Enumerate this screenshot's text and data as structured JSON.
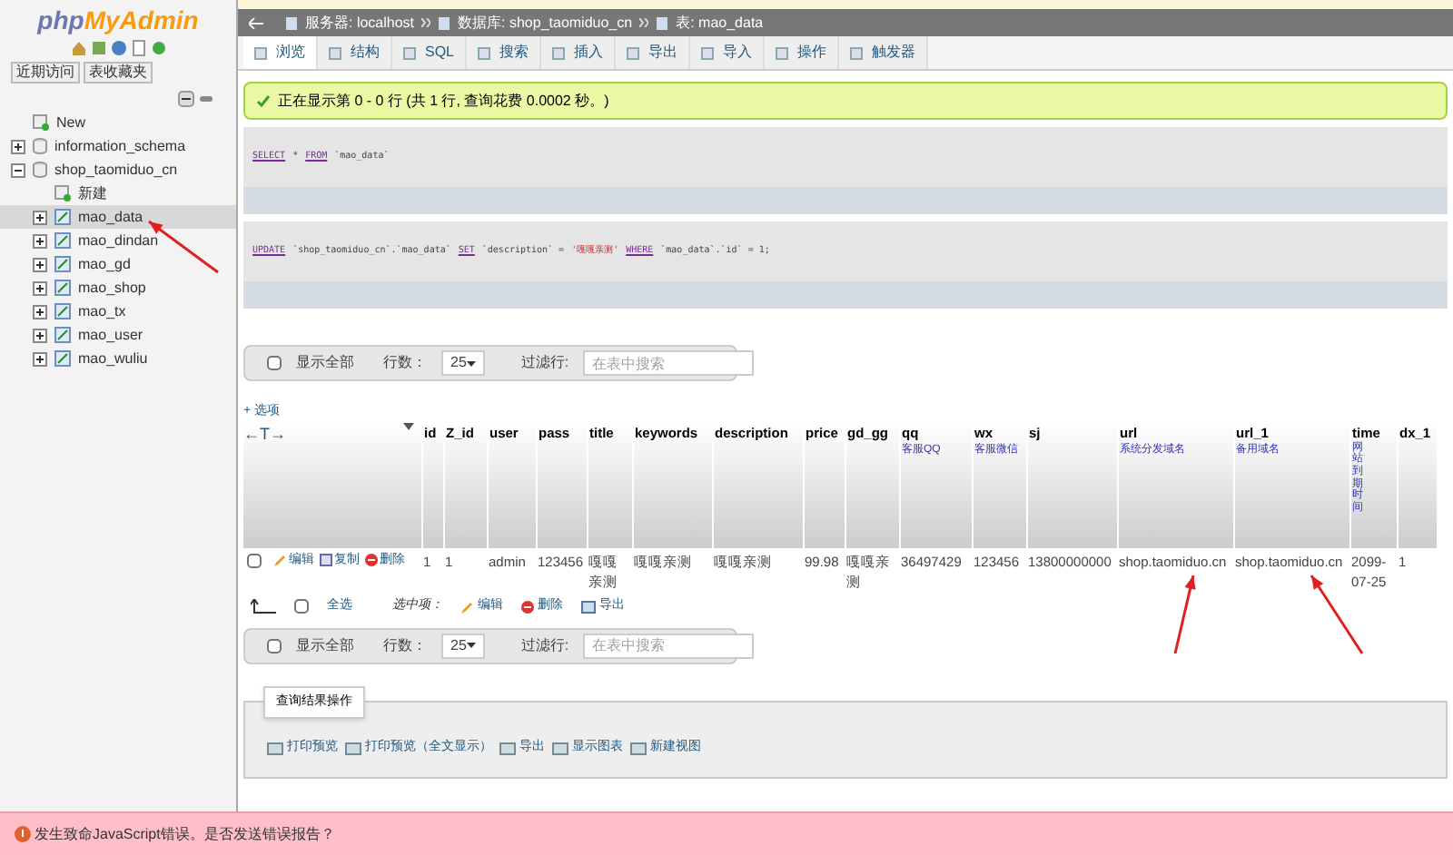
{
  "sidebar": {
    "logo": {
      "part_1": "php",
      "part_2": "MyAdmin"
    },
    "buttons": [
      "近期访问",
      "表收藏夹"
    ],
    "tree": [
      {
        "label": "New",
        "kind": "new",
        "selected": false
      },
      {
        "label": "information_schema",
        "kind": "db",
        "expanded": false,
        "selected": false
      },
      {
        "label": "shop_taomiduo_cn",
        "kind": "db",
        "expanded": true,
        "selected": false,
        "children": [
          {
            "label": "新建",
            "kind": "new",
            "selected": false
          },
          {
            "label": "mao_data",
            "kind": "table",
            "expanded": false,
            "selected": true
          },
          {
            "label": "mao_dindan",
            "kind": "table",
            "expanded": false,
            "selected": false
          },
          {
            "label": "mao_gd",
            "kind": "table",
            "expanded": false,
            "selected": false
          },
          {
            "label": "mao_shop",
            "kind": "table",
            "expanded": false,
            "selected": false
          },
          {
            "label": "mao_tx",
            "kind": "table",
            "expanded": false,
            "selected": false
          },
          {
            "label": "mao_user",
            "kind": "table",
            "expanded": false,
            "selected": false
          },
          {
            "label": "mao_wuliu",
            "kind": "table",
            "expanded": false,
            "selected": false
          }
        ]
      }
    ]
  },
  "breadcrumb": [
    "服务器: localhost",
    "数据库: shop_taomiduo_cn",
    "表: mao_data"
  ],
  "tabs": [
    {
      "label": "浏览",
      "selected": true
    },
    {
      "label": "结构",
      "selected": false
    },
    {
      "label": "SQL",
      "selected": false
    },
    {
      "label": "搜索",
      "selected": false
    },
    {
      "label": "插入",
      "selected": false
    },
    {
      "label": "导出",
      "selected": false
    },
    {
      "label": "导入",
      "selected": false
    },
    {
      "label": "操作",
      "selected": false
    },
    {
      "label": "触发器",
      "selected": false
    }
  ],
  "success_message": "正在显示第 0 - 0 行 (共 1 行, 查询花费 0.0002 秒。)",
  "queries": [
    [
      {
        "kind": "keyword",
        "text": "SELECT"
      },
      {
        "kind": "plain",
        "text": "*"
      },
      {
        "kind": "keyword",
        "text": "FROM"
      },
      {
        "kind": "plain",
        "text": "`mao_data`"
      }
    ],
    [
      {
        "kind": "keyword",
        "text": "UPDATE"
      },
      {
        "kind": "plain",
        "text": "`shop_taomiduo_cn`.`mao_data`"
      },
      {
        "kind": "keyword",
        "text": "SET"
      },
      {
        "kind": "plain",
        "text": "`description` ="
      },
      {
        "kind": "string",
        "text": "'嘎嘎亲测'"
      },
      {
        "kind": "keyword",
        "text": "WHERE"
      },
      {
        "kind": "plain",
        "text": "`mao_data`.`id` = 1;"
      }
    ]
  ],
  "nav_bars": [
    {
      "show_all": "显示全部",
      "show_all_checked": false,
      "rows_label": "行数：",
      "rows_value": "25",
      "filter_label": "过滤行:",
      "filter_placeholder": "在表中搜索"
    },
    {
      "show_all": "显示全部",
      "show_all_checked": false,
      "rows_label": "行数：",
      "rows_value": "25",
      "filter_label": "过滤行:",
      "filter_placeholder": "在表中搜索"
    }
  ],
  "table": {
    "options": "+ 选项",
    "sort_arrows": "←T→",
    "columns": [
      {
        "name": "id"
      },
      {
        "name": "Z_id"
      },
      {
        "name": "user"
      },
      {
        "name": "pass"
      },
      {
        "name": "title"
      },
      {
        "name": "keywords"
      },
      {
        "name": "description"
      },
      {
        "name": "price"
      },
      {
        "name": "gd_gg"
      },
      {
        "name": "qq",
        "comment": "客服QQ"
      },
      {
        "name": "wx",
        "comment": "客服微信"
      },
      {
        "name": "sj"
      },
      {
        "name": "url",
        "comment": "系统分发域名"
      },
      {
        "name": "url_1",
        "comment": "备用域名"
      },
      {
        "name": "time",
        "comment": "网站到期时间"
      },
      {
        "name": "dx_1"
      }
    ],
    "rows": [
      {
        "checked": false,
        "actions": [
          "编辑",
          "复制",
          "删除"
        ],
        "cells": [
          "1",
          "1",
          "admin",
          "123456",
          "嘎嘎亲测",
          "嘎嘎亲测",
          "嘎嘎亲测",
          "99.98",
          "嘎嘎亲测",
          "36497429",
          "123456",
          "13800000000",
          "shop.taomiduo.cn",
          "shop.taomiduo.cn",
          "2099-07-25",
          "1"
        ]
      }
    ]
  },
  "bulk": {
    "select_all": "全选",
    "select_all_checked": false,
    "selected_label": "选中项：",
    "actions": [
      "编辑",
      "删除",
      "导出"
    ]
  },
  "result_ops": {
    "title": "查询结果操作",
    "actions": [
      "打印预览",
      "打印预览（全文显示）",
      "导出",
      "显示图表",
      "新建视图"
    ]
  },
  "error_bar": "发生致命JavaScript错误。是否发送错误报告？"
}
